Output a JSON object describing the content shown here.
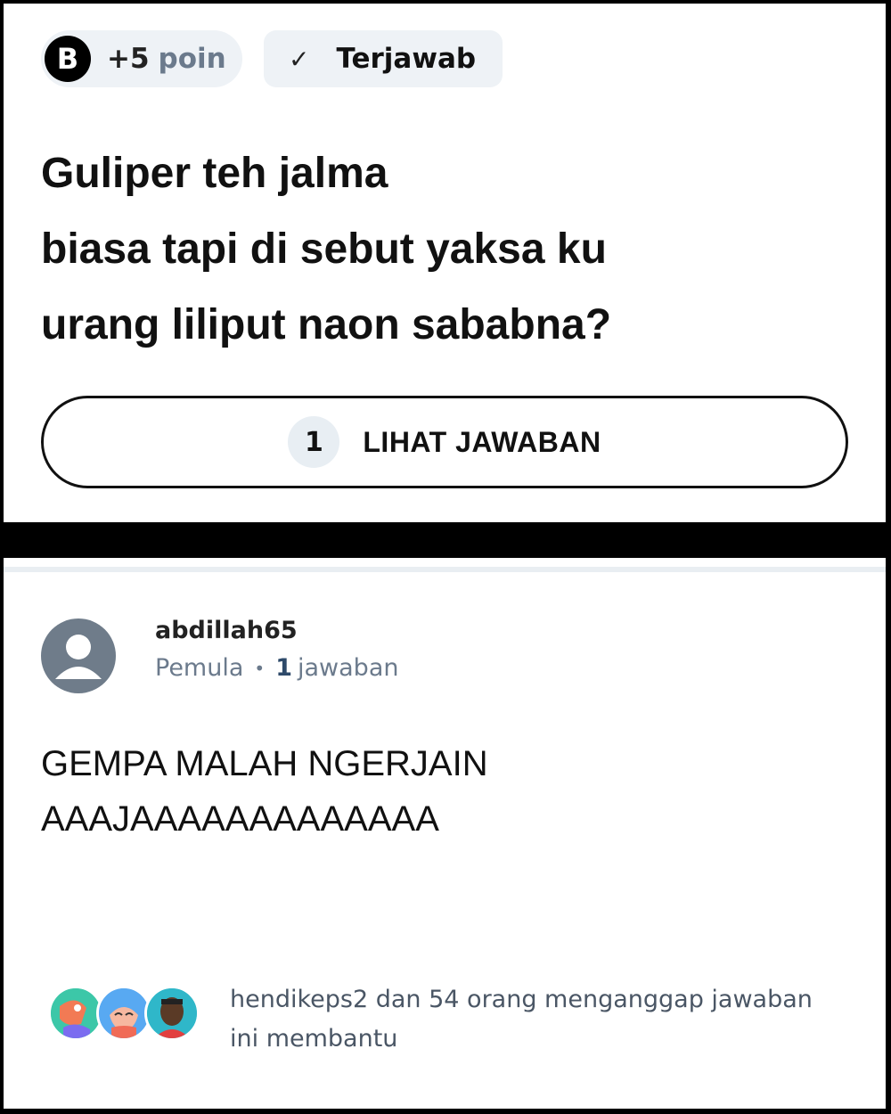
{
  "question_card": {
    "points_badge": {
      "logo": "B",
      "value": "+5",
      "unit": "poin"
    },
    "status_badge": {
      "icon": "check-icon",
      "label": "Terjawab"
    },
    "question_lines": [
      "Guliper teh jalma",
      "biasa tapi di sebut yaksa ku",
      "urang liliput naon sababna?"
    ],
    "view_answer_button": {
      "count": "1",
      "label": "LIHAT JAWABAN"
    }
  },
  "answer_card": {
    "user": {
      "name": "abdillah65",
      "rank": "Pemula",
      "answer_count": "1",
      "answer_count_label": "jawaban"
    },
    "answer_lines": [
      "GEMPA MALAH NGERJAIN",
      "AAAJAAAAAAAAAAAAA"
    ],
    "helpful": {
      "lines": [
        "hendikeps2 dan 54 orang menganggap jawaban",
        "ini membantu"
      ]
    }
  },
  "colors": {
    "chip_bg": "#eef2f6",
    "muted_text": "#6b7a8c",
    "avatar_gray": "#6f7c8a"
  }
}
